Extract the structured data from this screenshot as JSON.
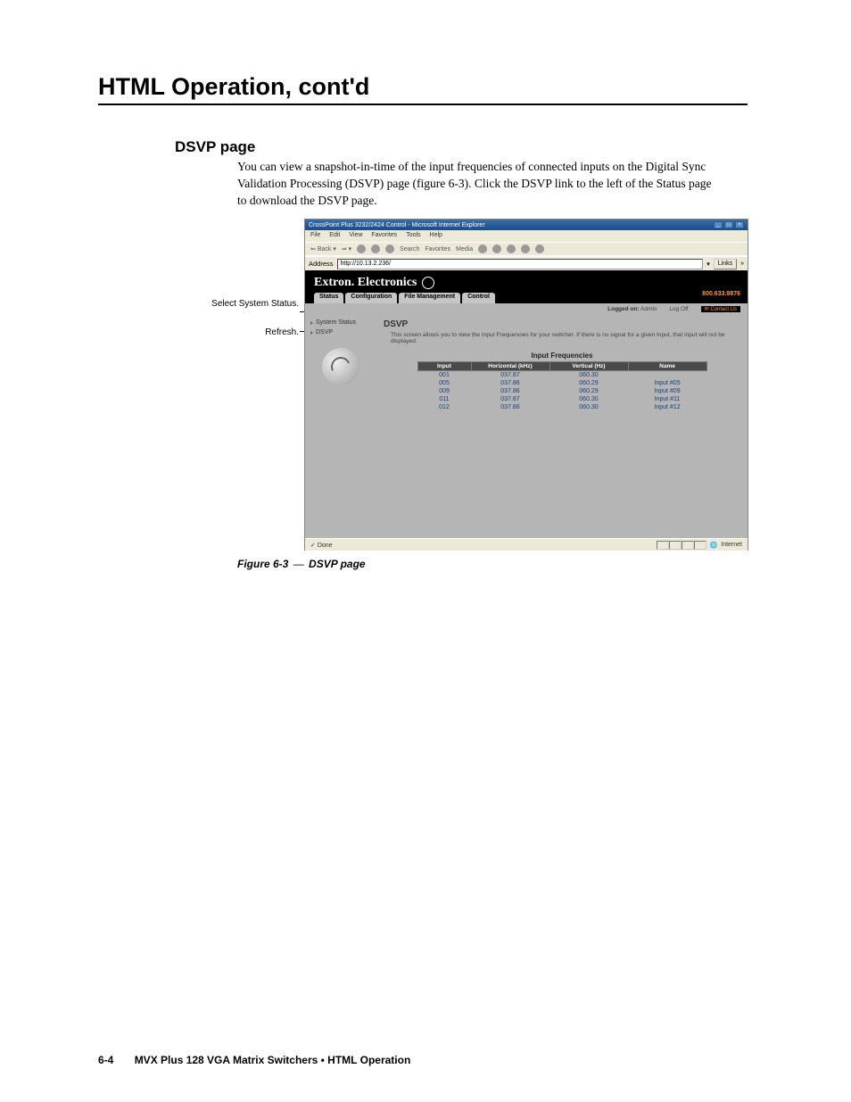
{
  "page": {
    "chapter_title": "HTML Operation, cont'd",
    "section_heading": "DSVP page",
    "body": "You can view a snapshot-in-time of the input frequencies of connected inputs on the Digital Sync Validation Processing (DSVP) page (figure 6-3).  Click the DSVP link to the left of the Status page to download the DSVP page.",
    "figure_caption_num": "Figure 6-3",
    "figure_caption_dash": " — ",
    "figure_caption_name": "DSVP page",
    "footer_page": "6-4",
    "footer_text": "MVX Plus 128 VGA Matrix Switchers • HTML Operation"
  },
  "callouts": {
    "c1": "Select System Status.",
    "c2": "Refresh."
  },
  "ie": {
    "title": "CrossPoint Plus 3232/2424 Control - Microsoft Internet Explorer",
    "menus": [
      "File",
      "Edit",
      "View",
      "Favorites",
      "Tools",
      "Help"
    ],
    "toolbar_back": "Back",
    "toolbar_items": [
      "Search",
      "Favorites",
      "Media"
    ],
    "address_label": "Address",
    "address_url": "http://10.13.2.236/",
    "links_label": "Links",
    "status_done": "Done",
    "status_zone": "Internet"
  },
  "web": {
    "brand": "Extron. Electronics",
    "tabs": [
      "Status",
      "Configuration",
      "File Management",
      "Control"
    ],
    "phone": "800.633.9876",
    "logged_on_label": "Logged on:",
    "logged_on_user": "Admin",
    "logoff": "Log Off",
    "contact": "Contact Us",
    "sidebar": {
      "items": [
        "System Status",
        "DSVP"
      ]
    },
    "dsvp_heading": "DSVP",
    "dsvp_desc": "This screen allows you to view the Input Frequencies for your switcher. If there is no signal for a given Input, that input will not be displayed.",
    "table_caption": "Input Frequencies",
    "table_headers": [
      "Input",
      "Horizontal (kHz)",
      "Vertical (Hz)",
      "Name"
    ],
    "rows": [
      {
        "input": "001",
        "h": "037.87",
        "v": "060.30",
        "name": ""
      },
      {
        "input": "005",
        "h": "037.86",
        "v": "060.29",
        "name": "Input #05"
      },
      {
        "input": "009",
        "h": "037.86",
        "v": "060.29",
        "name": "Input #09"
      },
      {
        "input": "011",
        "h": "037.87",
        "v": "060.30",
        "name": "Input #11"
      },
      {
        "input": "012",
        "h": "037.86",
        "v": "060.30",
        "name": "Input #12"
      }
    ]
  }
}
